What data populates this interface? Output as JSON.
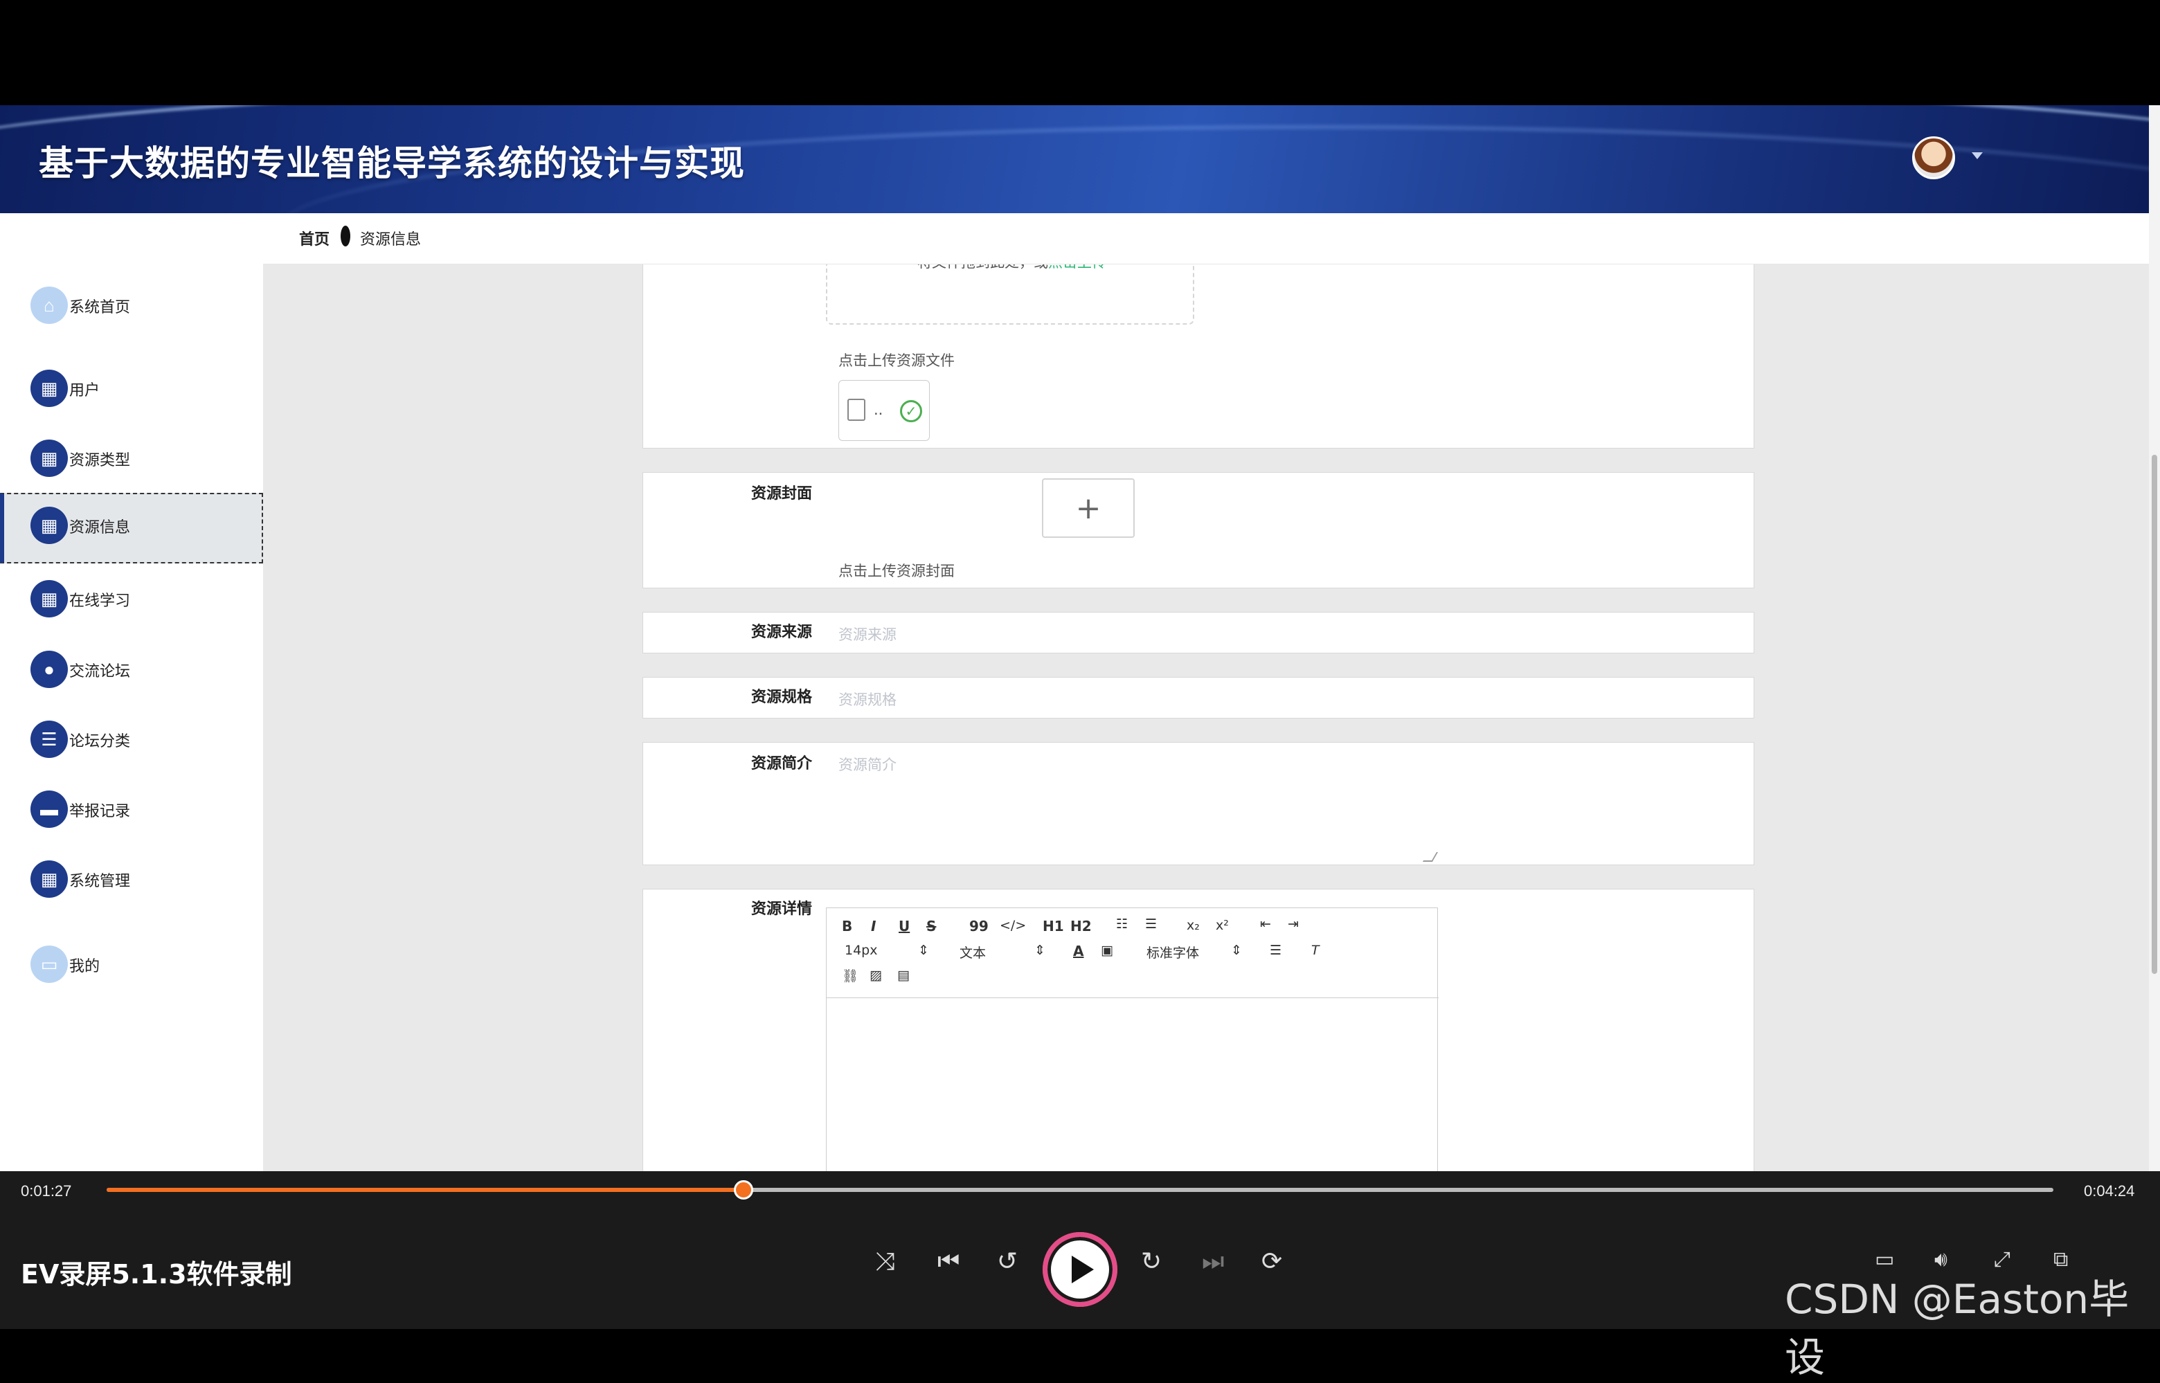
{
  "app": {
    "title": "基于大数据的专业智能导学系统的设计与实现"
  },
  "sidebar": {
    "items": [
      {
        "label": "系统首页",
        "icon": "home-icon"
      },
      {
        "label": "用户",
        "icon": "grid-icon"
      },
      {
        "label": "资源类型",
        "icon": "grid-icon"
      },
      {
        "label": "资源信息",
        "icon": "grid-icon",
        "active": true
      },
      {
        "label": "在线学习",
        "icon": "grid-icon"
      },
      {
        "label": "交流论坛",
        "icon": "pin-icon"
      },
      {
        "label": "论坛分类",
        "icon": "list-icon"
      },
      {
        "label": "举报记录",
        "icon": "monitor-icon"
      },
      {
        "label": "系统管理",
        "icon": "grid-icon"
      },
      {
        "label": "我的",
        "icon": "profile-card-icon"
      }
    ]
  },
  "breadcrumb": {
    "home": "首页",
    "current": "资源信息"
  },
  "form": {
    "upload": {
      "drop_text": "将文件拖到此处，或",
      "drop_link": "点击上传",
      "hint": "点击上传资源文件",
      "file_name": ".."
    },
    "cover": {
      "label": "资源封面",
      "hint": "点击上传资源封面",
      "plus": "+"
    },
    "source": {
      "label": "资源来源",
      "placeholder": "资源来源"
    },
    "spec": {
      "label": "资源规格",
      "placeholder": "资源规格"
    },
    "intro": {
      "label": "资源简介",
      "placeholder": "资源简介"
    },
    "detail": {
      "label": "资源详情",
      "toolbar": {
        "bold": "B",
        "italic": "I",
        "underline": "U",
        "strike": "S",
        "quote": "99",
        "code": "</>",
        "h1": "H1",
        "h2": "H2",
        "sub": "x₂",
        "sup": "x²",
        "font_size": "14px",
        "block": "文本",
        "font": "标准字体"
      }
    }
  },
  "player": {
    "elapsed": "0:01:27",
    "total": "0:04:24",
    "progress": 0.327,
    "name": "EV录屏5.1.3软件录制",
    "accent": "#f37021"
  },
  "watermark": "CSDN @Easton毕设"
}
